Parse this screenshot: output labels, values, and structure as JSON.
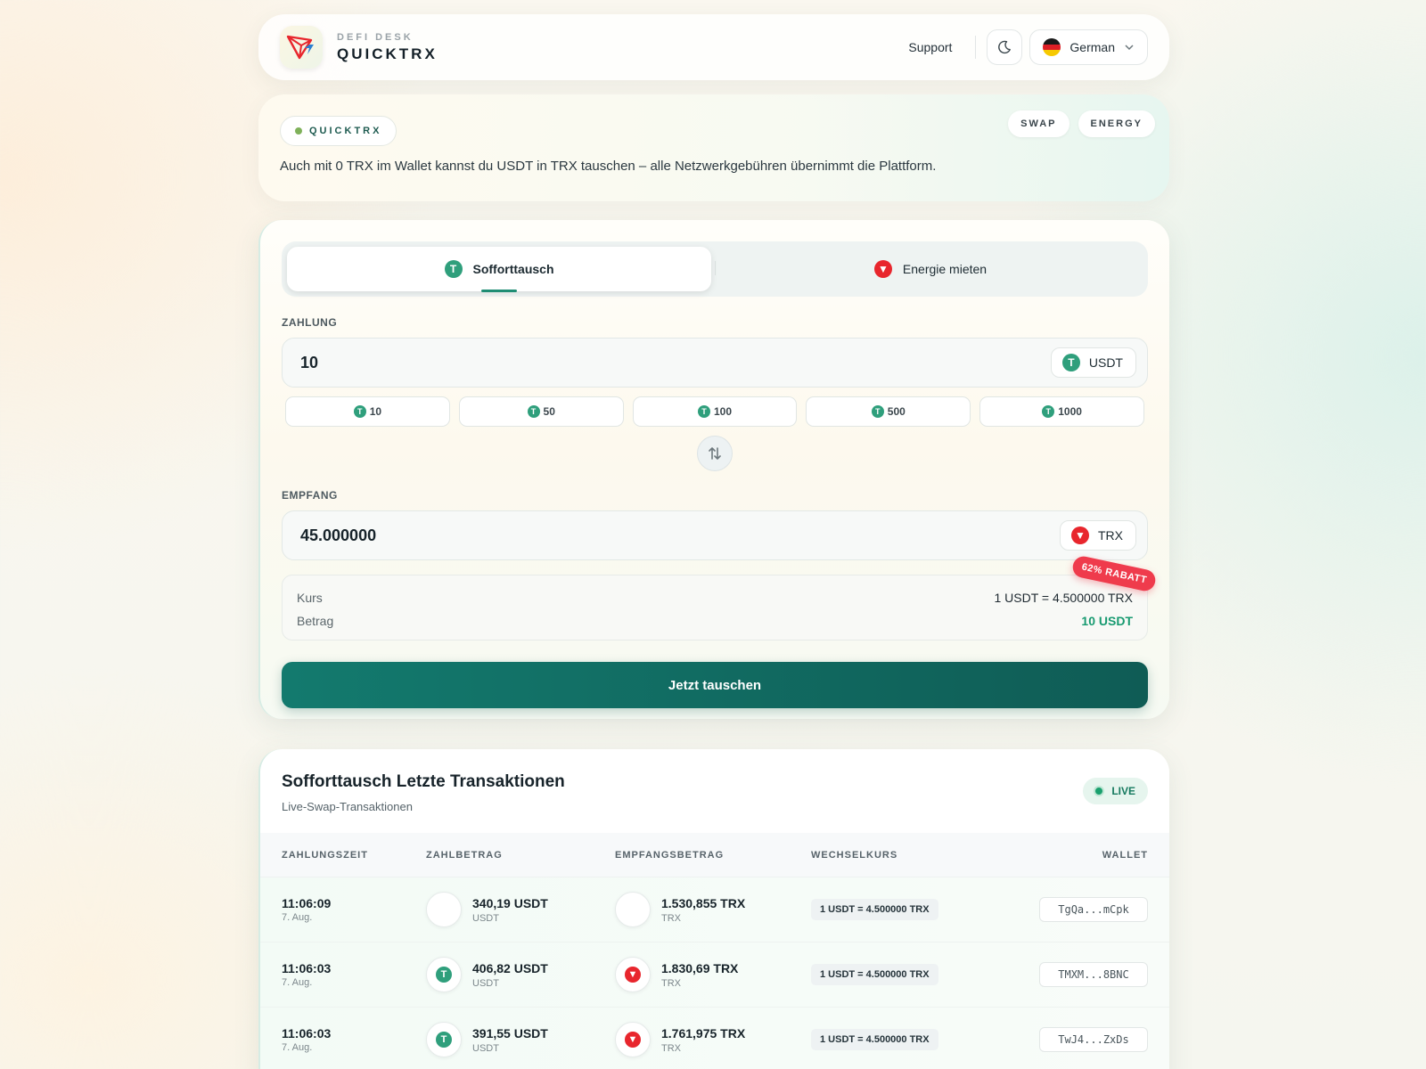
{
  "header": {
    "brand_sub": "DEFI DESK",
    "brand_name": "QUICKTRX",
    "support_label": "Support",
    "language_label": "German",
    "icons": [
      "logo-icon",
      "moon-icon",
      "flag-germany-icon",
      "chevron-down-icon"
    ]
  },
  "banner": {
    "pill_label": "QUICKTRX",
    "text": "Auch mit 0 TRX im Wallet kannst du USDT in TRX tauschen – alle Netzwerkgebühren übernimmt die Plattform.",
    "tags": [
      "SWAP",
      "ENERGY"
    ]
  },
  "swap": {
    "tabs": [
      {
        "label": "Sofforttausch",
        "active": true
      },
      {
        "label": "Energie mieten",
        "active": false
      }
    ],
    "pay_label": "ZAHLUNG",
    "pay_value": "10",
    "pay_token": "USDT",
    "quick_amounts": [
      "10",
      "50",
      "100",
      "500",
      "1000"
    ],
    "receive_label": "EMPFANG",
    "receive_value": "45.000000",
    "receive_token": "TRX",
    "rate_key": "Kurs",
    "rate_value": "1 USDT = 4.500000 TRX",
    "amount_key": "Betrag",
    "amount_value": "10 USDT",
    "discount_badge": "62% RABATT",
    "cta_label": "Jetzt tauschen"
  },
  "transactions": {
    "title": "Sofforttausch Letzte Transaktionen",
    "subtitle": "Live-Swap-Transaktionen",
    "live_label": "LIVE",
    "columns": [
      "ZAHLUNGSZEIT",
      "ZAHLBETRAG",
      "EMPFANGSBETRAG",
      "WECHSELKURS",
      "WALLET"
    ],
    "rows": [
      {
        "time": "11:06:09",
        "date": "7. Aug.",
        "pay": "340,19 USDT",
        "pay_unit": "USDT",
        "recv": "1.530,855 TRX",
        "recv_unit": "TRX",
        "rate": "1 USDT = 4.500000 TRX",
        "wallet": "TgQa...mCpk",
        "icons_loaded": false
      },
      {
        "time": "11:06:03",
        "date": "7. Aug.",
        "pay": "406,82 USDT",
        "pay_unit": "USDT",
        "recv": "1.830,69 TRX",
        "recv_unit": "TRX",
        "rate": "1 USDT = 4.500000 TRX",
        "wallet": "TMXM...8BNC",
        "icons_loaded": true
      },
      {
        "time": "11:06:03",
        "date": "7. Aug.",
        "pay": "391,55 USDT",
        "pay_unit": "USDT",
        "recv": "1.761,975 TRX",
        "recv_unit": "TRX",
        "rate": "1 USDT = 4.500000 TRX",
        "wallet": "TwJ4...ZxDs",
        "icons_loaded": true
      }
    ]
  },
  "colors": {
    "primary": "#137a6e",
    "usdt": "#2f9f7c",
    "trx": "#e8262d",
    "discount": "#ef3b4c",
    "positive": "#179a70"
  }
}
